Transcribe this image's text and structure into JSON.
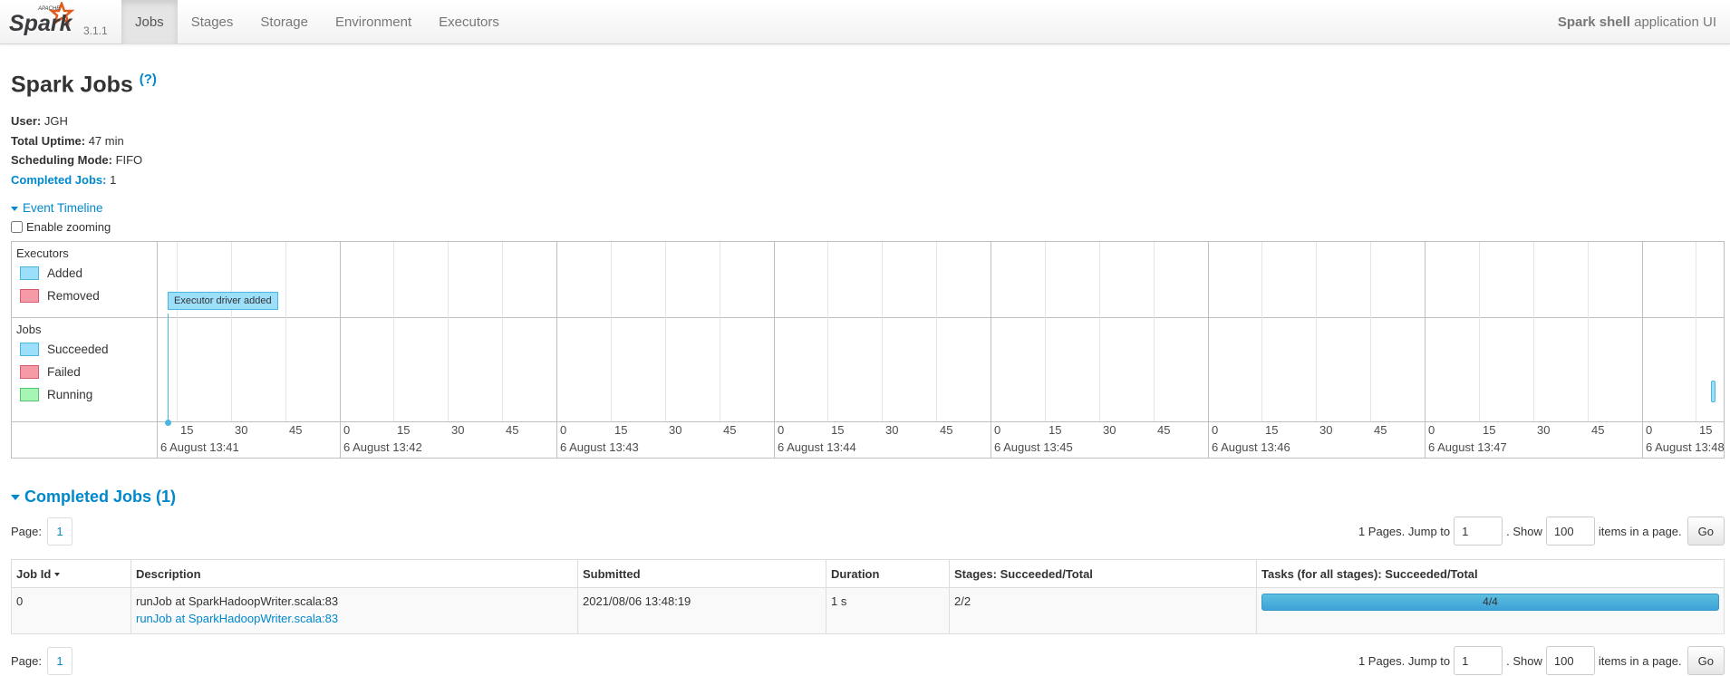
{
  "navbar": {
    "logo_word": "Spark",
    "logo_apache": "APACHE",
    "version": "3.1.1",
    "tabs": [
      {
        "label": "Jobs",
        "active": true
      },
      {
        "label": "Stages"
      },
      {
        "label": "Storage"
      },
      {
        "label": "Environment"
      },
      {
        "label": "Executors"
      }
    ],
    "app_name": "Spark shell",
    "app_suffix": " application UI"
  },
  "header": {
    "title": "Spark Jobs",
    "help": "(?)",
    "summary": [
      {
        "key": "User:",
        "value": " JGH"
      },
      {
        "key": "Total Uptime:",
        "value": " 47 min"
      },
      {
        "key": "Scheduling Mode:",
        "value": " FIFO"
      },
      {
        "key": "Completed Jobs:",
        "value": " 1"
      }
    ]
  },
  "timeline": {
    "toggle_label": "Event Timeline",
    "zoom_label": "Enable zooming",
    "zoom_checked": false,
    "executors_title": "Executors",
    "executors_legend": [
      {
        "label": "Added",
        "color": "#9cdffa",
        "border": "#4bb6df"
      },
      {
        "label": "Removed",
        "color": "#f79aa7",
        "border": "#d45a6c"
      }
    ],
    "jobs_title": "Jobs",
    "jobs_legend": [
      {
        "label": "Succeeded",
        "color": "#9cdffa",
        "border": "#4bb6df"
      },
      {
        "label": "Failed",
        "color": "#f79aa7",
        "border": "#d45a6c"
      },
      {
        "label": "Running",
        "color": "#a6f5b5",
        "border": "#57c46f"
      }
    ],
    "executor_event": "Executor driver added",
    "minute_labels": [
      "6 August 13:41",
      "6 August 13:42",
      "6 August 13:43",
      "6 August 13:44",
      "6 August 13:45",
      "6 August 13:46",
      "6 August 13:47",
      "6 August 13:48"
    ],
    "second_labels": [
      "0",
      "15",
      "30",
      "45"
    ]
  },
  "completed": {
    "title": "Completed Jobs (1)",
    "pager": {
      "page_label": "Page:",
      "page": "1",
      "pages_text": "1 Pages. Jump to",
      "jump_value": "1",
      "show_text": ". Show",
      "show_value": "100",
      "items_text": "items in a page.",
      "go": "Go"
    },
    "columns": [
      "Job Id",
      "Description",
      "Submitted",
      "Duration",
      "Stages: Succeeded/Total",
      "Tasks (for all stages): Succeeded/Total"
    ],
    "rows": [
      {
        "job_id": "0",
        "description": "runJob at SparkHadoopWriter.scala:83",
        "description_link": "runJob at SparkHadoopWriter.scala:83",
        "submitted": "2021/08/06 13:48:19",
        "duration": "1 s",
        "stages": "2/2",
        "tasks": "4/4",
        "tasks_progress": 1.0
      }
    ]
  }
}
